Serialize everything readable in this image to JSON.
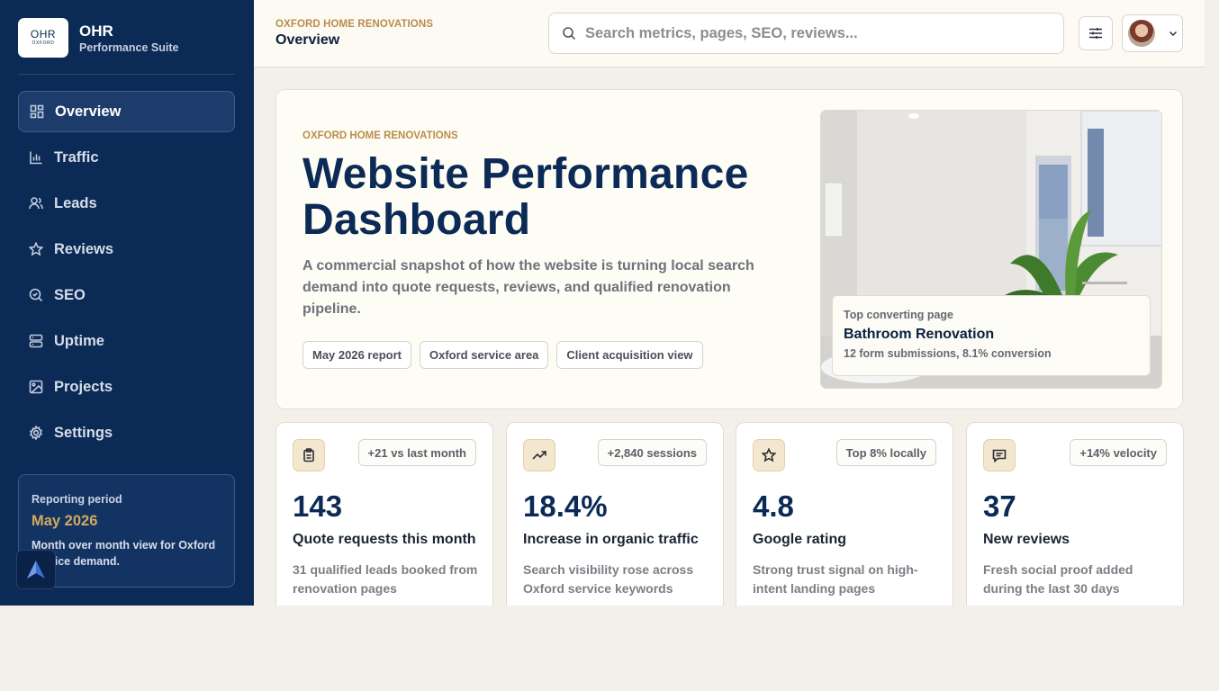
{
  "brand": {
    "logo_main": "OHR",
    "logo_small": "OXFORD",
    "title": "OHR",
    "subtitle": "Performance Suite"
  },
  "sidebar": {
    "items": [
      {
        "label": "Overview",
        "icon": "grid-icon",
        "active": true
      },
      {
        "label": "Traffic",
        "icon": "bar-chart-icon"
      },
      {
        "label": "Leads",
        "icon": "users-icon"
      },
      {
        "label": "Reviews",
        "icon": "star-icon"
      },
      {
        "label": "SEO",
        "icon": "search-check-icon"
      },
      {
        "label": "Uptime",
        "icon": "server-icon"
      },
      {
        "label": "Projects",
        "icon": "image-icon"
      },
      {
        "label": "Settings",
        "icon": "gear-icon"
      }
    ],
    "period": {
      "label": "Reporting period",
      "value": "May 2026",
      "description": "Month over month view for Oxford service demand."
    }
  },
  "header": {
    "eyebrow": "OXFORD HOME RENOVATIONS",
    "title": "Overview",
    "search_placeholder": "Search metrics, pages, SEO, reviews..."
  },
  "hero": {
    "eyebrow": "OXFORD HOME RENOVATIONS",
    "title": "Website Performance Dashboard",
    "description": "A commercial snapshot of how the website is turning local search demand into quote requests, reviews, and qualified renovation pipeline.",
    "chips": [
      "May 2026 report",
      "Oxford service area",
      "Client acquisition view"
    ],
    "image_card": {
      "label": "Top converting page",
      "title": "Bathroom Renovation",
      "subtitle": "12 form submissions, 8.1% conversion"
    }
  },
  "stats": [
    {
      "icon": "clipboard-icon",
      "badge": "+21 vs last month",
      "value": "143",
      "label": "Quote requests this month",
      "description": "31 qualified leads booked from renovation pages"
    },
    {
      "icon": "trending-up-icon",
      "badge": "+2,840 sessions",
      "value": "18.4%",
      "label": "Increase in organic traffic",
      "description": "Search visibility rose across Oxford service keywords"
    },
    {
      "icon": "star-icon",
      "badge": "Top 8% locally",
      "value": "4.8",
      "label": "Google rating",
      "description": "Strong trust signal on high-intent landing pages"
    },
    {
      "icon": "message-icon",
      "badge": "+14% velocity",
      "value": "37",
      "label": "New reviews",
      "description": "Fresh social proof added during the last 30 days"
    }
  ]
}
